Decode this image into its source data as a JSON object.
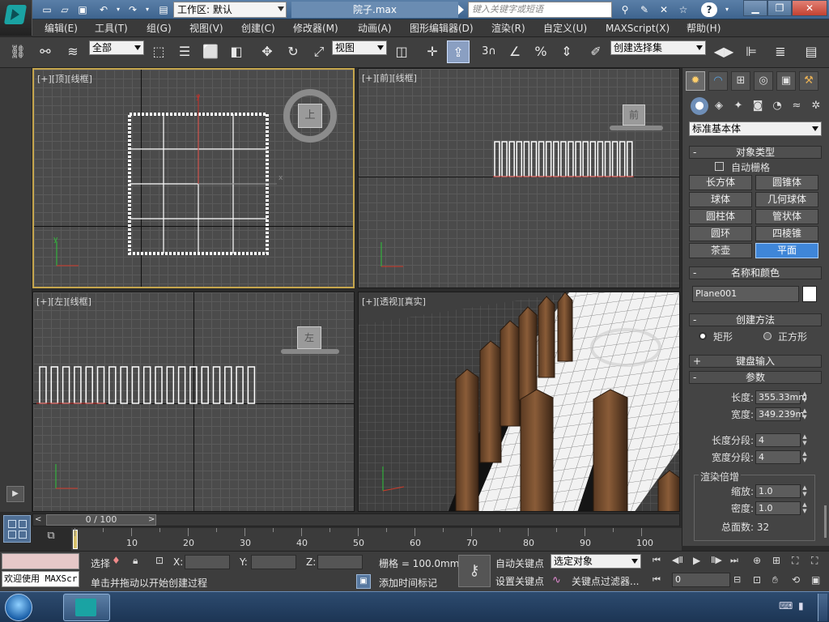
{
  "window": {
    "workspace_label": "工作区: 默认",
    "filename": "院子.max",
    "search_placeholder": "键入关键字或短语",
    "help_label": "?"
  },
  "menu": [
    "编辑(E)",
    "工具(T)",
    "组(G)",
    "视图(V)",
    "创建(C)",
    "修改器(M)",
    "动画(A)",
    "图形编辑器(D)",
    "渲染(R)",
    "自定义(U)",
    "MAXScript(X)",
    "帮助(H)"
  ],
  "toolbar": {
    "selection_filter": "全部",
    "ref_coord": "视图",
    "snap_label": "3",
    "named_selection": "创建选择集"
  },
  "viewports": [
    {
      "id": "top",
      "label": "[+][顶][线框]",
      "cube_label": "上"
    },
    {
      "id": "front",
      "label": "[+][前][线框]",
      "cube_label": "前"
    },
    {
      "id": "left",
      "label": "[+][左][线框]",
      "cube_label": "左"
    },
    {
      "id": "persp",
      "label": "[+][透视][真实]"
    }
  ],
  "command_panel": {
    "category": "标准基本体",
    "object_type": {
      "title": "对象类型",
      "autogrid": "自动栅格",
      "buttons": [
        "长方体",
        "圆锥体",
        "球体",
        "几何球体",
        "圆柱体",
        "管状体",
        "圆环",
        "四棱锥",
        "茶壶",
        "平面"
      ],
      "active": "平面"
    },
    "name_color": {
      "title": "名称和颜色",
      "name": "Plane001",
      "swatch": "#ffffff"
    },
    "creation_method": {
      "title": "创建方法",
      "options": [
        "矩形",
        "正方形"
      ],
      "selected": "矩形"
    },
    "keyboard_entry": {
      "title": "键盘输入"
    },
    "params": {
      "title": "参数",
      "length_label": "长度:",
      "length": "355.33mm",
      "width_label": "宽度:",
      "width": "349.239m",
      "length_segs_label": "长度分段:",
      "length_segs": "4",
      "width_segs_label": "宽度分段:",
      "width_segs": "4",
      "render_mult_title": "渲染倍增",
      "scale_label": "缩放:",
      "scale": "1.0",
      "density_label": "密度:",
      "density": "1.0",
      "total_faces": "总面数: 32"
    }
  },
  "timeline": {
    "frame_readout": "0 / 100",
    "current_frame": 0,
    "total_frames": 100,
    "ticks": [
      "10",
      "20",
      "30",
      "40",
      "50",
      "60",
      "70",
      "80",
      "90",
      "100"
    ]
  },
  "status": {
    "welcome": "欢迎使用 MAXScr",
    "selection_label": "选择",
    "x_label": "X:",
    "y_label": "Y:",
    "z_label": "Z:",
    "grid": "栅格 = 100.0mm",
    "prompt": "单击并拖动以开始创建过程",
    "add_time_tag": "添加时间标记",
    "auto_key": "自动关键点",
    "set_key": "设置关键点",
    "key_mode": "选定对象",
    "key_filters": "关键点过滤器...",
    "frame_field": "0"
  },
  "colors": {
    "active_viewport_border": "#c6a64d",
    "active_button": "#3f86d8",
    "titlebar": "#4a6f99"
  }
}
